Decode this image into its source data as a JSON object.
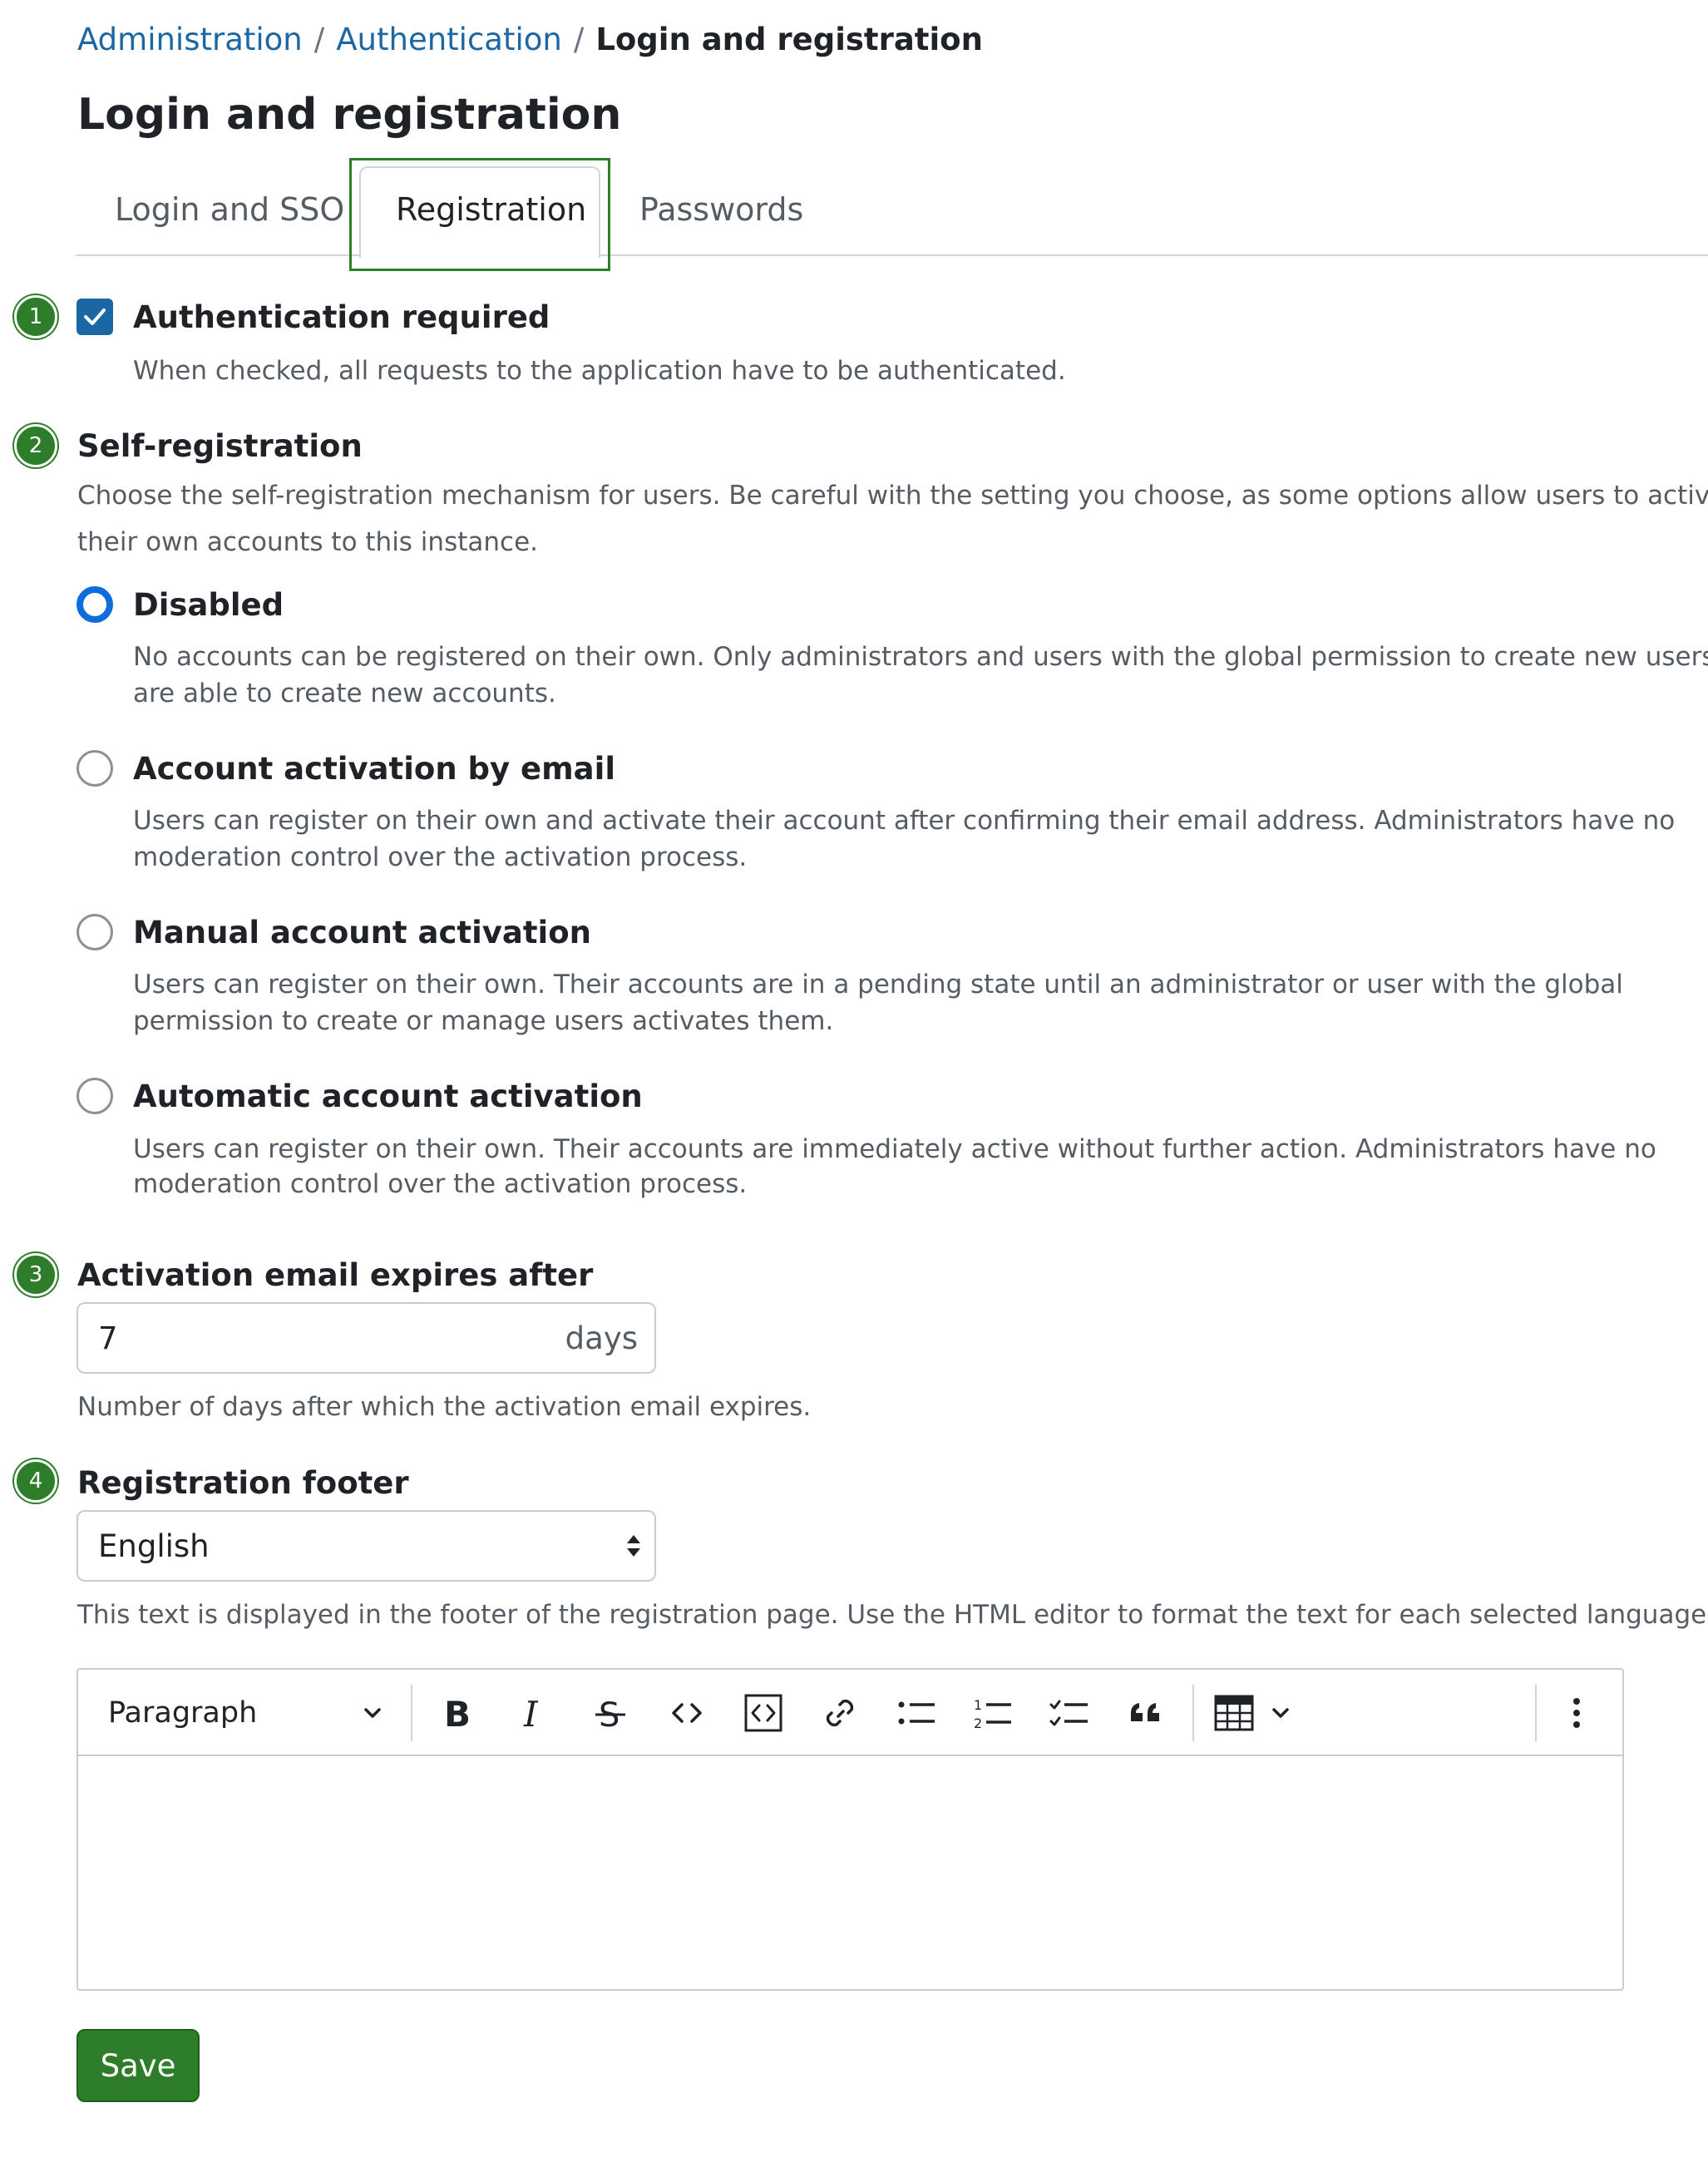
{
  "breadcrumb": {
    "items": [
      "Administration",
      "Authentication"
    ],
    "separator": "/",
    "current": "Login and registration"
  },
  "page_title": "Login and registration",
  "tabs": [
    {
      "label": "Login and SSO",
      "active": false
    },
    {
      "label": "Registration",
      "active": true
    },
    {
      "label": "Passwords",
      "active": false
    }
  ],
  "badges": [
    "1",
    "2",
    "3",
    "4"
  ],
  "auth_required": {
    "label": "Authentication required",
    "help": "When checked, all requests to the application have to be authenticated.",
    "checked": true
  },
  "self_registration": {
    "label": "Self-registration",
    "help_line1": "Choose the self-registration mechanism for users. Be careful with the setting you choose, as some options allow users to activate",
    "help_line2": "their own accounts to this instance.",
    "options": [
      {
        "label": "Disabled",
        "help_line1": "No accounts can be registered on their own. Only administrators and users with the global permission to create new users",
        "help_line2": "are able to create new accounts.",
        "selected": true
      },
      {
        "label": "Account activation by email",
        "help_line1": "Users can register on their own and activate their account after confirming their email address. Administrators have no",
        "help_line2": "moderation control over the activation process.",
        "selected": false
      },
      {
        "label": "Manual account activation",
        "help_line1": "Users can register on their own. Their accounts are in a pending state until an administrator or user with the global",
        "help_line2": "permission to create or manage users activates them.",
        "selected": false
      },
      {
        "label": "Automatic account activation",
        "help_line1": "Users can register on their own. Their accounts are immediately active without further action. Administrators have no",
        "help_line2": "moderation control over the activation process.",
        "selected": false
      }
    ]
  },
  "activation_expiry": {
    "label": "Activation email expires after",
    "value": "7",
    "unit": "days",
    "help": "Number of days after which the activation email expires."
  },
  "registration_footer": {
    "label": "Registration footer",
    "language": "English",
    "help": "This text is displayed in the footer of the registration page. Use the HTML editor to format the text for each selected language.",
    "editor": {
      "paragraph_label": "Paragraph",
      "toolbar_icons": [
        "bold-icon",
        "italic-icon",
        "strikethrough-icon",
        "inline-code-icon",
        "code-block-icon",
        "link-icon",
        "bulleted-list-icon",
        "numbered-list-icon",
        "todo-list-icon",
        "blockquote-icon",
        "table-icon",
        "more-options-icon"
      ],
      "content": ""
    }
  },
  "save_label": "Save",
  "colors": {
    "accent_green": "#2d7d2a",
    "link_blue": "#1a67a3",
    "radio_blue": "#0f6cdb"
  }
}
